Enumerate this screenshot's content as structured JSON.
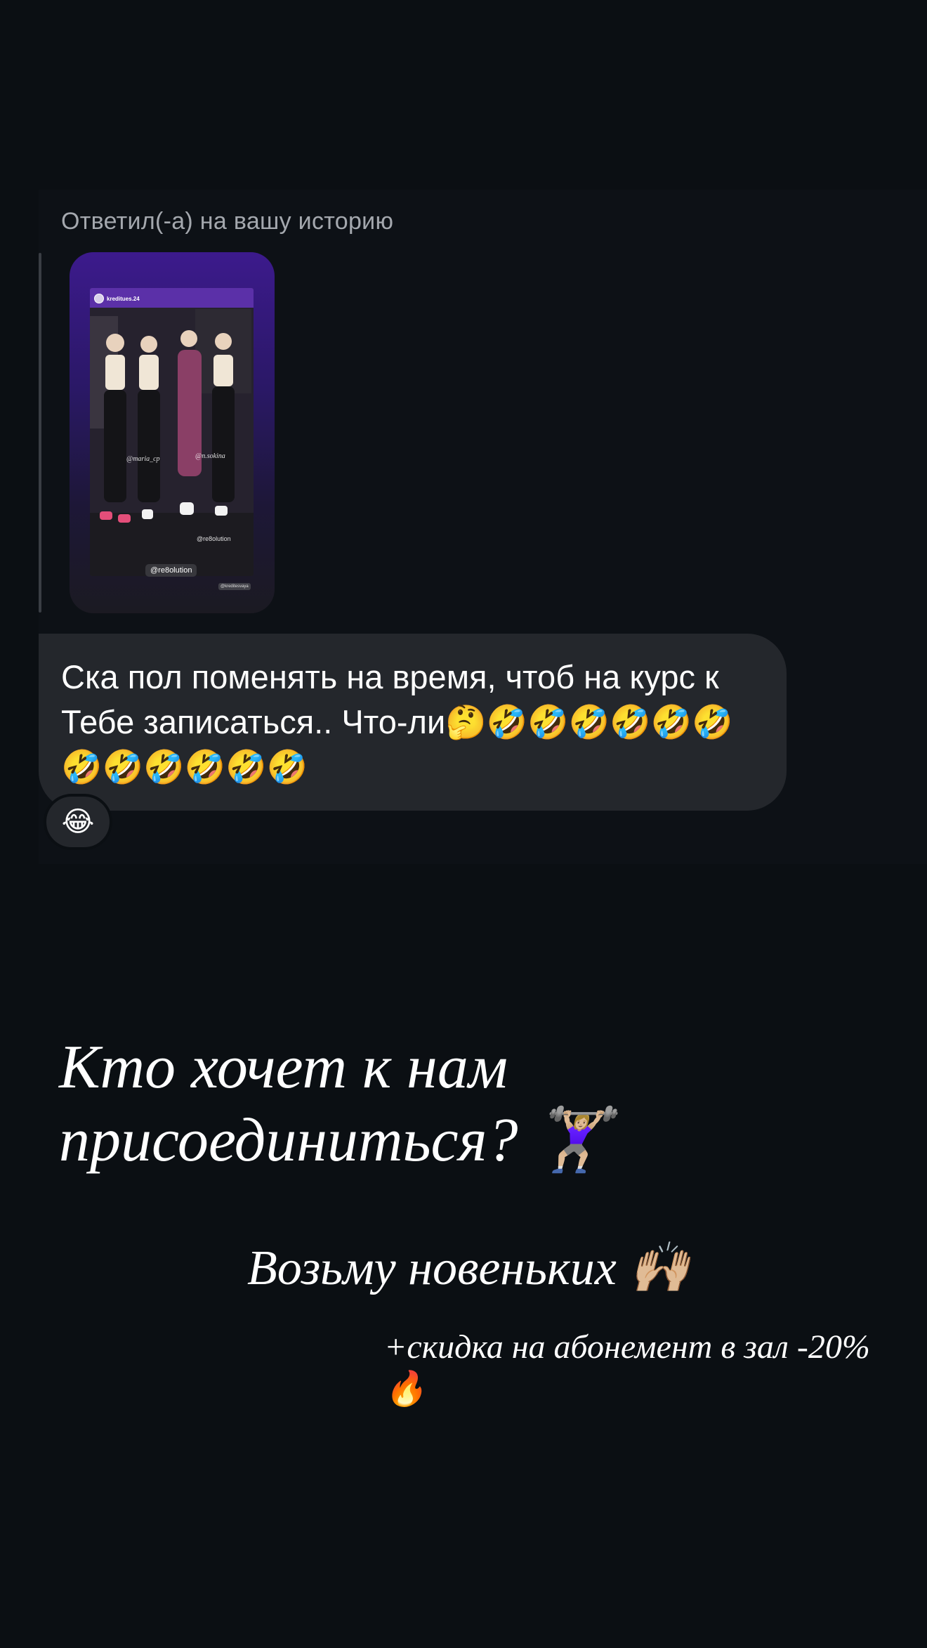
{
  "chat": {
    "reply_label": "Ответил(-а) на вашу историю",
    "story": {
      "username": "kreditues.24",
      "tags": [
        "@maria_cp",
        "@n.sokina",
        "@re8olution"
      ],
      "tag_button": "@re8olution",
      "watermark": "@kreditesvaya"
    },
    "message": "Ска пол поменять на время, чтоб на курс к Тебе записаться.. Что-ли🤔🤣🤣🤣🤣🤣🤣🤣🤣🤣🤣🤣🤣",
    "reaction": "😂"
  },
  "story_overlay": {
    "headline": "Кто хочет к нам присоединиться? 🏋🏼‍♀️",
    "subline": "Возьму новеньких 🙌🏼",
    "promo": "+скидка на абонемент в зал -20% 🔥"
  },
  "colors": {
    "background": "#0b0f13",
    "bubble": "#24272c",
    "muted_text": "#a4a8ae",
    "story_gradient_top": "#3c1a8c"
  }
}
